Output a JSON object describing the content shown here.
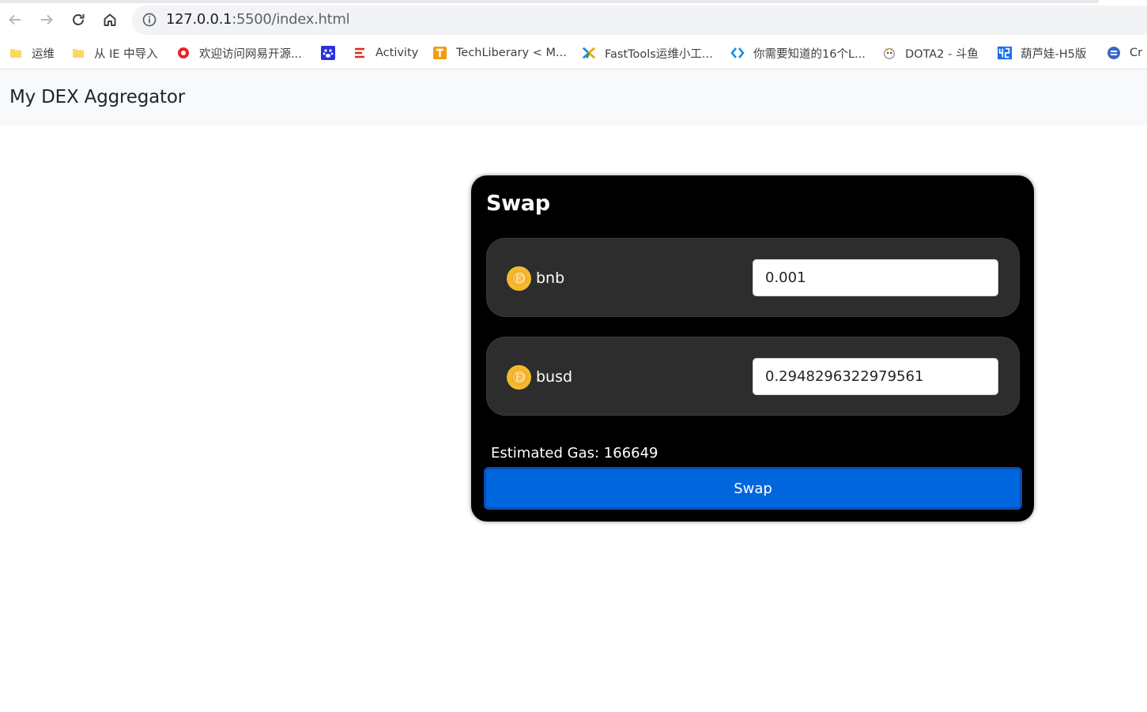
{
  "browser": {
    "url_host": "127.0.0.1",
    "url_path": ":5500/index.html",
    "bookmarks": [
      {
        "label": "运维",
        "icon": "folder-icon"
      },
      {
        "label": "从 IE 中导入",
        "icon": "folder-icon"
      },
      {
        "label": "欢迎访问网易开源...",
        "icon": "netease-icon"
      },
      {
        "label": "",
        "icon": "baidu-paw-icon"
      },
      {
        "label": "Activity",
        "icon": "activity-icon"
      },
      {
        "label": "TechLiberary < M...",
        "icon": "tech-t-icon"
      },
      {
        "label": "FastTools运维小工...",
        "icon": "fasttools-icon"
      },
      {
        "label": "你需要知道的16个L...",
        "icon": "code-brackets-icon"
      },
      {
        "label": "DOTA2 - 斗鱼",
        "icon": "douyu-icon"
      },
      {
        "label": "葫芦娃-H5版",
        "icon": "h5-icon"
      },
      {
        "label": "Cr",
        "icon": "round-blue-icon"
      }
    ]
  },
  "navbar": {
    "brand": "My DEX Aggregator"
  },
  "swap": {
    "title": "Swap",
    "from": {
      "token": "bnb",
      "amount": "0.001",
      "icon": "coin-icon"
    },
    "to": {
      "token": "busd",
      "amount": "0.2948296322979561",
      "icon": "coin-icon"
    },
    "gas_label": "Estimated Gas: 166649",
    "button_label": "Swap"
  },
  "colors": {
    "card_bg": "#000000",
    "token_box_bg": "#2d2d2d",
    "button_bg": "#0066dd",
    "coin": "#f3ba2f",
    "navbar_bg": "#f8f9fa"
  }
}
